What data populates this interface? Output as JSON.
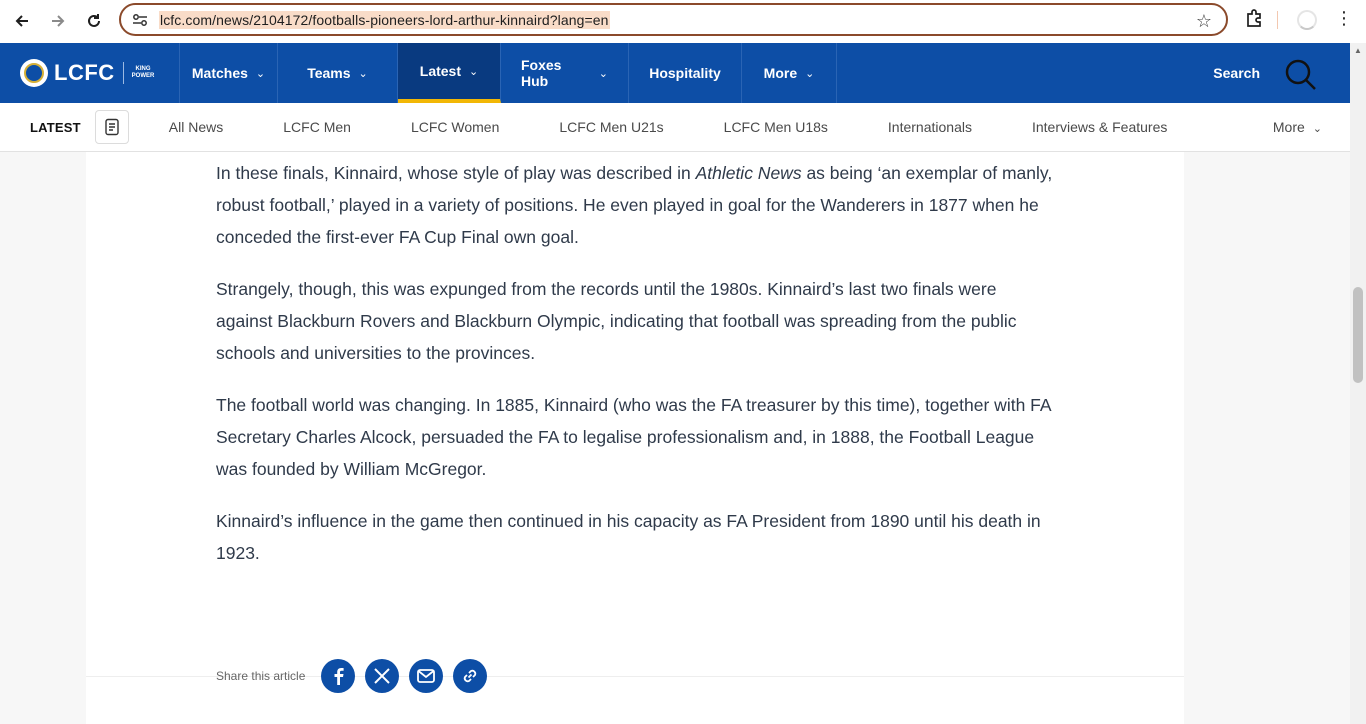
{
  "browser": {
    "url": "lcfc.com/news/2104172/footballs-pioneers-lord-arthur-kinnaird?lang=en",
    "icons": [
      "back-icon",
      "forward-icon",
      "reload-icon",
      "site-settings-icon",
      "bookmark-star-icon",
      "extensions-icon",
      "loading-spinner-icon",
      "menu-kebab-icon"
    ]
  },
  "header": {
    "logo": "LCFC",
    "sponsor_line1": "KING",
    "sponsor_line2": "POWER",
    "menu": [
      {
        "label": "Matches",
        "dropdown": true
      },
      {
        "label": "Teams",
        "dropdown": true
      },
      {
        "label": "Latest",
        "dropdown": true,
        "active": true
      },
      {
        "label": "Foxes Hub",
        "dropdown": true
      },
      {
        "label": "Hospitality",
        "dropdown": false
      },
      {
        "label": "More",
        "dropdown": true
      }
    ],
    "search_label": "Search",
    "colors": {
      "primary": "#0d4ea6",
      "active_underline": "#f2b705"
    }
  },
  "subnav": {
    "section": "LATEST",
    "links": [
      "All News",
      "LCFC Men",
      "LCFC Women",
      "LCFC Men U21s",
      "LCFC Men U18s",
      "Internationals",
      "Interviews & Features"
    ],
    "more": "More"
  },
  "article": {
    "p1_before": "In these finals, Kinnaird, whose style of play was described in ",
    "p1_em": "Athletic News",
    "p1_after": " as being ‘an exemplar of manly, robust football,’ played in a variety of positions. He even played in goal for the Wanderers in 1877 when he conceded the first-ever FA Cup Final own goal.",
    "p2": "Strangely, though, this was expunged from the records until the 1980s. Kinnaird’s last two finals were against Blackburn Rovers and Blackburn Olympic, indicating that football was spreading from the public schools and universities to the provinces.",
    "p3": "The football world was changing. In 1885, Kinnaird (who was the FA treasurer by this time), together with FA Secretary Charles Alcock, persuaded the FA to legalise professionalism and, in 1888, the Football League was founded by William McGregor.",
    "p4": "Kinnaird’s influence in the game then continued in his capacity as FA President from 1890 until his death in 1923.",
    "share_label": "Share this article",
    "share_buttons": [
      "facebook-icon",
      "x-icon",
      "email-icon",
      "link-icon"
    ]
  }
}
